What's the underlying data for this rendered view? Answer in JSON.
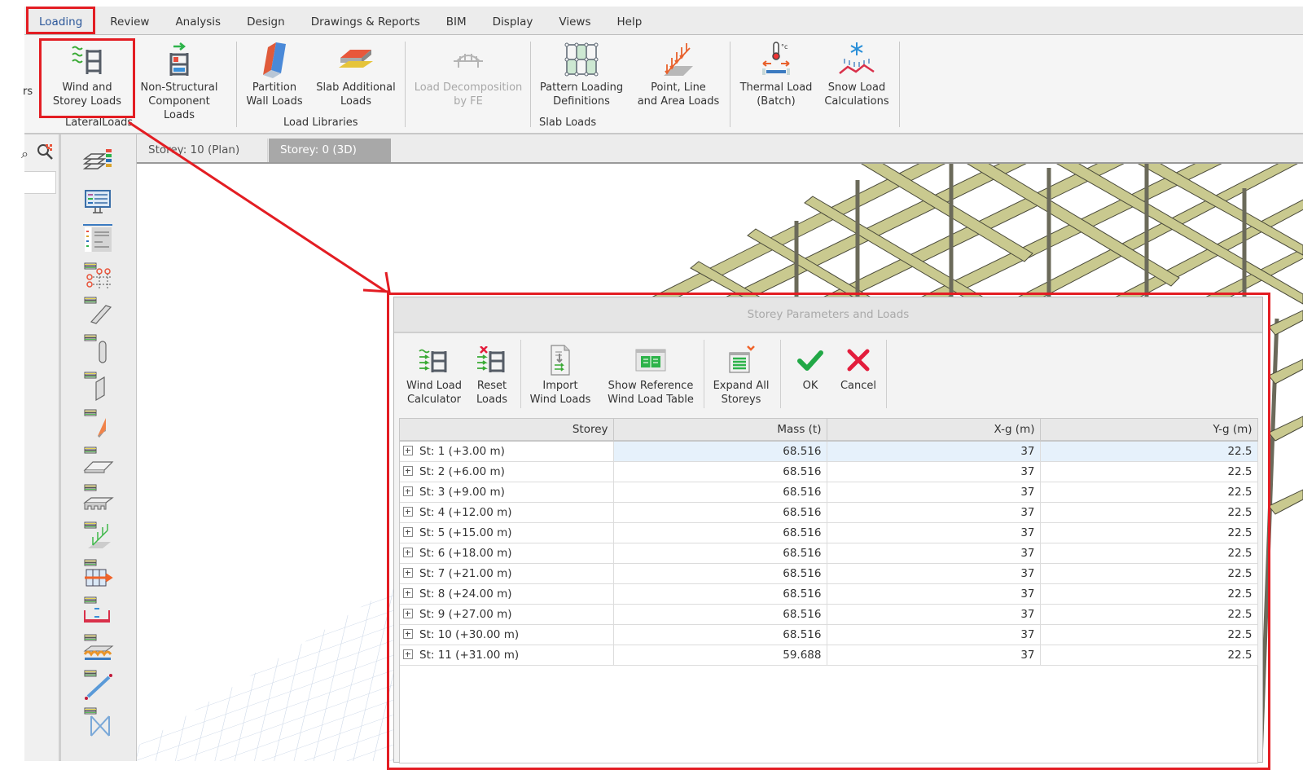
{
  "menu": {
    "tabs": [
      {
        "label": "Loading",
        "active": true
      },
      {
        "label": "Review"
      },
      {
        "label": "Analysis"
      },
      {
        "label": "Design"
      },
      {
        "label": "Drawings & Reports"
      },
      {
        "label": "BIM"
      },
      {
        "label": "Display"
      },
      {
        "label": "Views"
      },
      {
        "label": "Help"
      }
    ]
  },
  "ribbon": {
    "cut_label": "rs",
    "buttons": [
      {
        "id": "wind-storey",
        "line1": "Wind and",
        "line2": "Storey Loads",
        "icon": "wind-storey-icon"
      },
      {
        "id": "non-structural",
        "line1": "Non-Structural",
        "line2": "Component Loads",
        "icon": "non-structural-icon"
      },
      {
        "id": "partition-wall",
        "line1": "Partition",
        "line2": "Wall Loads",
        "icon": "partition-wall-icon"
      },
      {
        "id": "slab-additional",
        "line1": "Slab Additional",
        "line2": "Loads",
        "icon": "slab-additional-icon"
      },
      {
        "id": "load-decomposition",
        "line1": "Load Decomposition",
        "line2": "by FE",
        "icon": "bridge-icon",
        "disabled": true
      },
      {
        "id": "pattern-loading",
        "line1": "Pattern Loading",
        "line2": "Definitions",
        "icon": "pattern-grid-icon"
      },
      {
        "id": "point-line-area",
        "line1": "Point, Line",
        "line2": "and Area Loads",
        "icon": "distributed-load-icon"
      },
      {
        "id": "thermal-load",
        "line1": "Thermal Load",
        "line2": "(Batch)",
        "icon": "thermometer-icon"
      },
      {
        "id": "snow-load",
        "line1": "Snow Load",
        "line2": "Calculations",
        "icon": "snowflake-icon"
      }
    ],
    "groups": [
      "LateralLoads",
      "Load Libraries",
      "Slab Loads"
    ]
  },
  "doc_tabs": [
    {
      "label": "Storey: 10 (Plan)",
      "active": false
    },
    {
      "label": "Storey: 0 (3D)",
      "active": true,
      "close": "✕"
    }
  ],
  "vertical_toolbar": {
    "items": [
      "storey-layers-icon",
      "monitor-settings-icon",
      "list-panel-icon",
      "grid-axes-icon",
      "beam-icon",
      "column-icon",
      "shear-wall-icon",
      "wall-load-icon",
      "slab-icon",
      "ribbed-slab-icon",
      "foundation-load-icon",
      "lateral-grid-icon",
      "opening-icon",
      "raft-foundation-icon",
      "brace-icon",
      "cross-brace-icon"
    ]
  },
  "dialog": {
    "title": "Storey Parameters and Loads",
    "toolbar": [
      {
        "line1": "Wind Load",
        "line2": "Calculator"
      },
      {
        "line1": "Reset",
        "line2": "Loads"
      },
      {
        "line1": "Import",
        "line2": "Wind Loads"
      },
      {
        "line1": "Show Reference",
        "line2": "Wind Load Table"
      },
      {
        "line1": "Expand All",
        "line2": "Storeys"
      },
      {
        "line1": "OK",
        "line2": ""
      },
      {
        "line1": "Cancel",
        "line2": ""
      }
    ],
    "columns": [
      "Storey",
      "Mass (t)",
      "X-g (m)",
      "Y-g (m)"
    ],
    "rows": [
      {
        "storey": "St: 1 (+3.00 m)",
        "mass": "68.516",
        "xg": "37",
        "yg": "22.5"
      },
      {
        "storey": "St: 2 (+6.00 m)",
        "mass": "68.516",
        "xg": "37",
        "yg": "22.5"
      },
      {
        "storey": "St: 3 (+9.00 m)",
        "mass": "68.516",
        "xg": "37",
        "yg": "22.5"
      },
      {
        "storey": "St: 4 (+12.00 m)",
        "mass": "68.516",
        "xg": "37",
        "yg": "22.5"
      },
      {
        "storey": "St: 5 (+15.00 m)",
        "mass": "68.516",
        "xg": "37",
        "yg": "22.5"
      },
      {
        "storey": "St: 6 (+18.00 m)",
        "mass": "68.516",
        "xg": "37",
        "yg": "22.5"
      },
      {
        "storey": "St: 7 (+21.00 m)",
        "mass": "68.516",
        "xg": "37",
        "yg": "22.5"
      },
      {
        "storey": "St: 8 (+24.00 m)",
        "mass": "68.516",
        "xg": "37",
        "yg": "22.5"
      },
      {
        "storey": "St: 9 (+27.00 m)",
        "mass": "68.516",
        "xg": "37",
        "yg": "22.5"
      },
      {
        "storey": "St: 10 (+30.00 m)",
        "mass": "68.516",
        "xg": "37",
        "yg": "22.5"
      },
      {
        "storey": "St: 11 (+31.00 m)",
        "mass": "59.688",
        "xg": "37",
        "yg": "22.5"
      }
    ]
  },
  "colors": {
    "annotation_red": "#e31d23",
    "frame_beam": "#c9c98f",
    "selection": "#e6f1fb"
  }
}
